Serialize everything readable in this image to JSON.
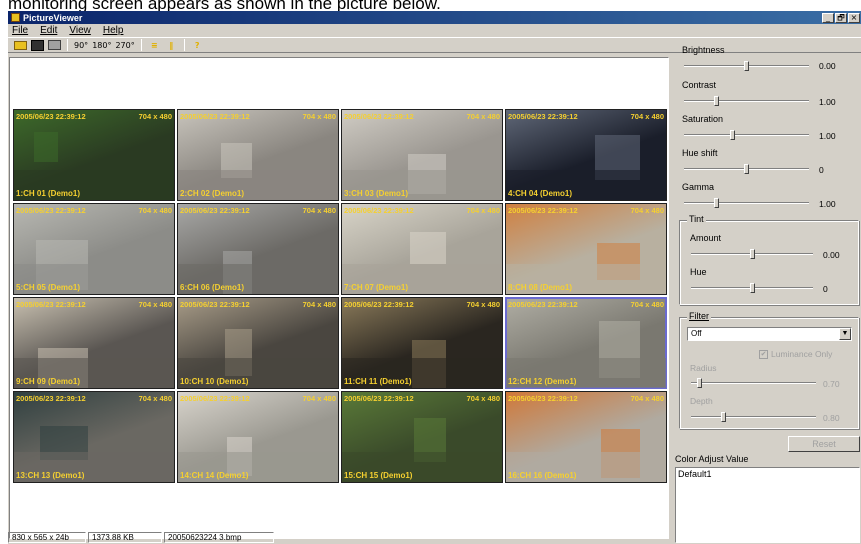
{
  "caption": "monitoring screen appears as shown in the picture below.",
  "window": {
    "title": "PictureViewer",
    "controls": [
      "_",
      "🗗",
      "×"
    ]
  },
  "menu": [
    "File",
    "Edit",
    "View",
    "Help"
  ],
  "toolbar": {
    "open_icon": "folder-open-icon",
    "save_icon": "disk-icon",
    "print_icon": "printer-icon",
    "rotate90": "90°",
    "rotate180": "180°",
    "rotate270": "270°",
    "flip_v": "≡",
    "flip_h": "‖",
    "help": "?"
  },
  "cameras": [
    {
      "timestamp": "2005/06/23 22:39:12",
      "resolution": "704 x 480",
      "label": "1:CH 01 (Demo1)",
      "bg": "#2a3a22",
      "accent": "#3d6a2a"
    },
    {
      "timestamp": "2005/06/23 22:39:12",
      "resolution": "704 x 480",
      "label": "2:CH 02 (Demo1)",
      "bg": "#8a8680",
      "accent": "#c8c4bc"
    },
    {
      "timestamp": "2005/06/23 22:39:12",
      "resolution": "704 x 480",
      "label": "3:CH 03 (Demo1)",
      "bg": "#9a9690",
      "accent": "#d0ccc4"
    },
    {
      "timestamp": "2005/06/23 22:39:12",
      "resolution": "704 x 480",
      "label": "4:CH 04 (Demo1)",
      "bg": "#1a1e2a",
      "accent": "#606878"
    },
    {
      "timestamp": "2005/06/23 22:39:12",
      "resolution": "704 x 480",
      "label": "5:CH 05 (Demo1)",
      "bg": "#8c8c88",
      "accent": "#b8b8b2"
    },
    {
      "timestamp": "2005/06/23 22:39:12",
      "resolution": "704 x 480",
      "label": "6:CH 06 (Demo1)",
      "bg": "#6c6a66",
      "accent": "#a8a8a6"
    },
    {
      "timestamp": "2005/06/23 22:39:12",
      "resolution": "704 x 480",
      "label": "7:CH 07 (Demo1)",
      "bg": "#a8a49a",
      "accent": "#d8d4c8"
    },
    {
      "timestamp": "2005/06/23 22:39:12",
      "resolution": "704 x 480",
      "label": "8:CH 08 (Demo1)",
      "bg": "#b8b0a0",
      "accent": "#d08040"
    },
    {
      "timestamp": "2005/06/23 22:39:12",
      "resolution": "704 x 480",
      "label": "9:CH 09 (Demo1)",
      "bg": "#5a5652",
      "accent": "#c8c0b0"
    },
    {
      "timestamp": "2005/06/23 22:39:12",
      "resolution": "704 x 480",
      "label": "10:CH 10 (Demo1)",
      "bg": "#4a4640",
      "accent": "#a89c88"
    },
    {
      "timestamp": "2005/06/23 22:39:12",
      "resolution": "704 x 480",
      "label": "11:CH 11 (Demo1)",
      "bg": "#2a2620",
      "accent": "#8a7a5a"
    },
    {
      "timestamp": "2005/06/23 22:39:12",
      "resolution": "704 x 480",
      "label": "12:CH 12 (Demo1)",
      "bg": "#7a7870",
      "accent": "#b0aea4"
    },
    {
      "timestamp": "2005/06/23 22:39:12",
      "resolution": "704 x 480",
      "label": "13:CH 13 (Demo1)",
      "bg": "#6a6862",
      "accent": "#304040"
    },
    {
      "timestamp": "2005/06/23 22:39:12",
      "resolution": "704 x 480",
      "label": "14:CH 14 (Demo1)",
      "bg": "#9a9890",
      "accent": "#d8d4cc"
    },
    {
      "timestamp": "2005/06/23 22:39:12",
      "resolution": "704 x 480",
      "label": "15:CH 15 (Demo1)",
      "bg": "#3a4a2a",
      "accent": "#5a7a38"
    },
    {
      "timestamp": "2005/06/23 22:39:12",
      "resolution": "704 x 480",
      "label": "16:CH 16 (Demo1)",
      "bg": "#b0aaa0",
      "accent": "#d07838"
    }
  ],
  "selected_camera": 11,
  "status": [
    "830 x 565 x 24b",
    "1373.88 KB",
    "20050623224 3.bmp"
  ],
  "adjust": {
    "brightness": {
      "label": "Brightness",
      "value": "0.00",
      "level": 0.5
    },
    "contrast": {
      "label": "Contrast",
      "value": "1.00",
      "level": 0.25
    },
    "saturation": {
      "label": "Saturation",
      "value": "1.00",
      "level": 0.38
    },
    "hue_shift": {
      "label": "Hue shift",
      "value": "0",
      "level": 0.5
    },
    "gamma": {
      "label": "Gamma",
      "value": "1.00",
      "level": 0.25
    }
  },
  "tint": {
    "title": "Tint",
    "amount": {
      "label": "Amount",
      "value": "0.00",
      "level": 0.5
    },
    "hue": {
      "label": "Hue",
      "value": "0",
      "level": 0.5
    }
  },
  "filter": {
    "title": "Filter",
    "selected": "Off",
    "luminance_label": "Luminance Only",
    "luminance_checked": true,
    "radius": {
      "label": "Radius",
      "value": "0.70",
      "level": 0.05
    },
    "depth": {
      "label": "Depth",
      "value": "0.80",
      "level": 0.25
    }
  },
  "reset_label": "Reset",
  "color_adjust": {
    "title": "Color Adjust Value",
    "items": [
      "Default1"
    ]
  }
}
